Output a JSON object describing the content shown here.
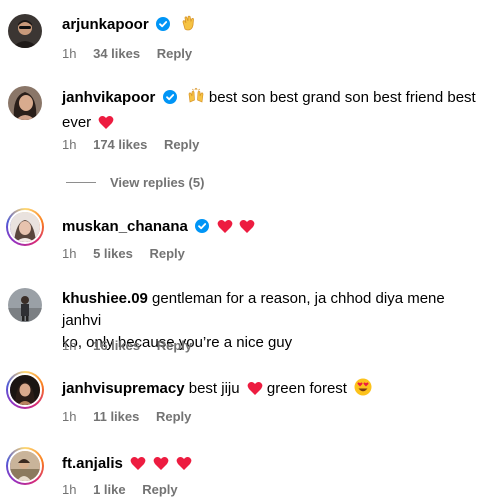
{
  "comments": [
    {
      "username": "arjunkapoor",
      "verified": true,
      "text": "",
      "emoji": "clap",
      "time": "1h",
      "likes": "34 likes",
      "reply": "Reply"
    },
    {
      "username": "janhvikapoor",
      "verified": true,
      "emoji": "raised-hands",
      "text": " best son best grand son best friend best",
      "text2": "ever",
      "time": "1h",
      "likes": "174 likes",
      "reply": "Reply"
    },
    {
      "username": "muskan_chanana",
      "verified": true,
      "text": "",
      "time": "1h",
      "likes": "5 likes",
      "reply": "Reply"
    },
    {
      "username": "khushiee.09",
      "verified": false,
      "text": " gentleman for a reason, ja chhod diya mene janhvi",
      "text2": "ko, only because you’re a nice guy",
      "time": "1h",
      "likes": "16 likes",
      "reply": "Reply"
    },
    {
      "username": "janhvisupremacy",
      "verified": false,
      "text": " best jiju",
      "text_b": " green forest",
      "time": "1h",
      "likes": "11 likes",
      "reply": "Reply"
    },
    {
      "username": "ft.anjalis",
      "verified": false,
      "text": "",
      "time": "1h",
      "likes": "1 like",
      "reply": "Reply"
    }
  ],
  "view_replies": "View replies (5)",
  "colors": {
    "heart": "#ed1c40",
    "verified": "#0095f6",
    "meta": "#737373"
  }
}
